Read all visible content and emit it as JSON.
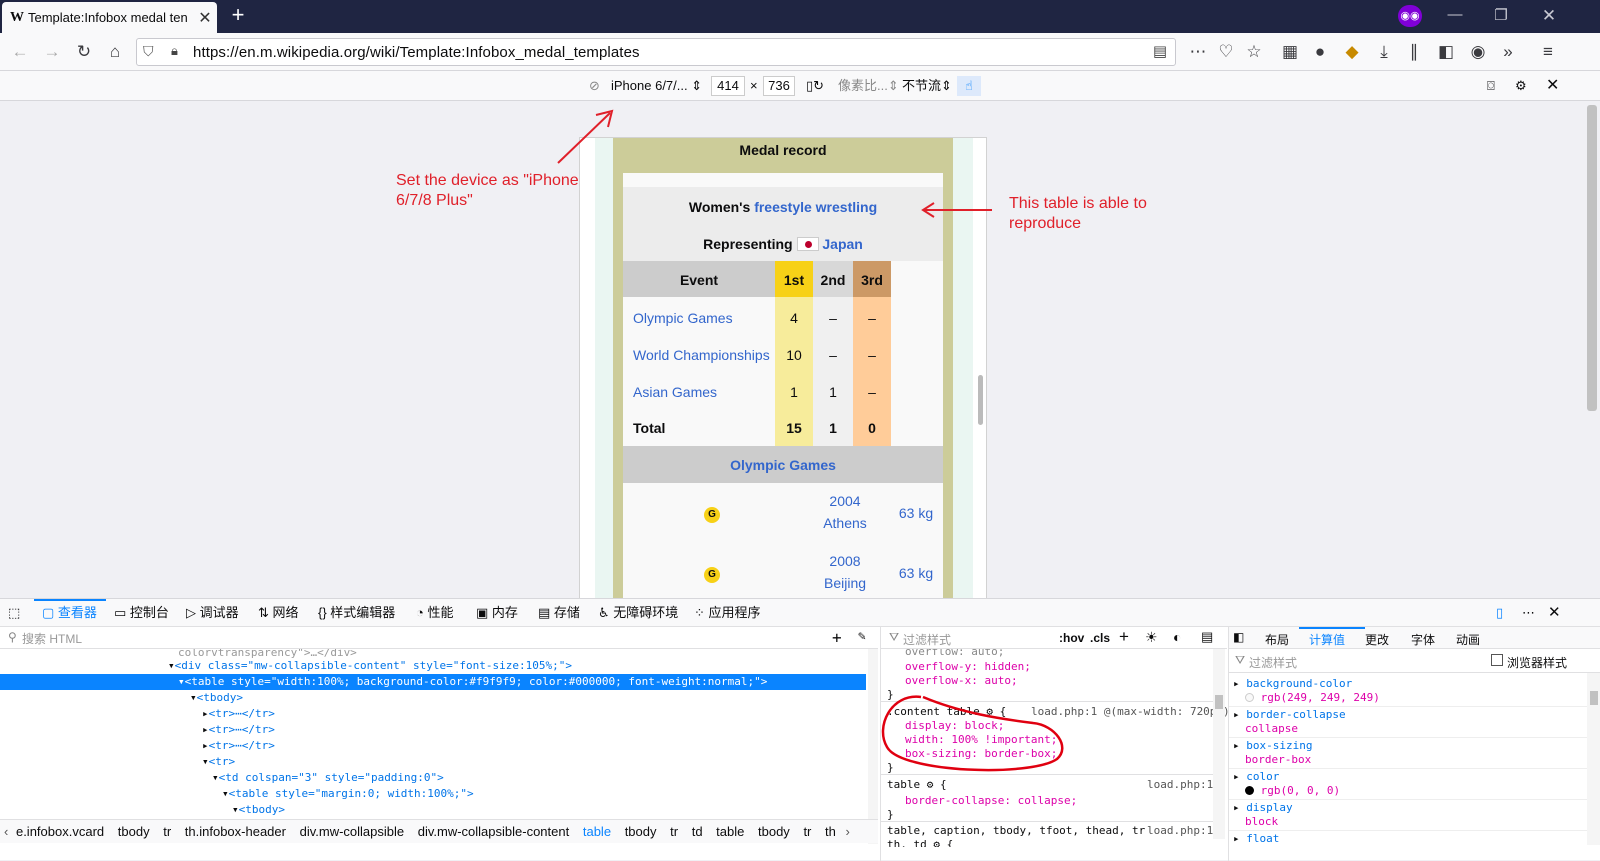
{
  "browser": {
    "tab_title": "Template:Infobox medal ten",
    "favicon": "W",
    "url": "https://en.m.wikipedia.org/wiki/Template:Infobox_medal_templates"
  },
  "rdm": {
    "device": "iPhone 6/7/...",
    "width": "414",
    "times": "×",
    "height": "736",
    "dpr": "像素比...",
    "throttle": "不节流"
  },
  "annotations": {
    "device_note": "Set the device as \"iPhone 6/7/8 Plus\"",
    "table_note": "This table is able to reproduce"
  },
  "infobox": {
    "title": "Medal record",
    "sport_prefix": "Women's",
    "sport_link": "freestyle wrestling",
    "representing": "Representing",
    "country": "Japan",
    "headers": [
      "Event",
      "1st",
      "2nd",
      "3rd"
    ],
    "rows": [
      {
        "event": "Olympic Games",
        "g": "4",
        "s": "–",
        "b": "–"
      },
      {
        "event": "World Championships",
        "g": "10",
        "s": "–",
        "b": "–"
      },
      {
        "event": "Asian Games",
        "g": "1",
        "s": "1",
        "b": "–"
      }
    ],
    "total": {
      "event": "Total",
      "g": "15",
      "s": "1",
      "b": "0"
    },
    "section": "Olympic Games",
    "medals": [
      {
        "badge": "G",
        "year": "2004",
        "place": "Athens",
        "weight": "63 kg"
      },
      {
        "badge": "G",
        "year": "2008",
        "place": "Beijing",
        "weight": "63 kg"
      }
    ]
  },
  "devtools": {
    "tabs": [
      "查看器",
      "控制台",
      "调试器",
      "网络",
      "样式编辑器",
      "性能",
      "内存",
      "存储",
      "无障碍环境",
      "应用程序"
    ],
    "search_placeholder": "搜索 HTML",
    "filter_placeholder": "过滤样式",
    "hov": ":hov",
    "cls": ".cls",
    "sidebar_tabs": [
      "布局",
      "计算值",
      "更改",
      "字体",
      "动画"
    ],
    "computed_filter": "过滤样式",
    "browser_styles": "浏览器样式",
    "markup_lines": [
      "colorvtransparency\">…</div>",
      "<div class=\"mw-collapsible-content\" style=\"font-size:105%;\">",
      "<table style=\"width:100%; background-color:#f9f9f9; color:#000000; font-weight:normal;\">",
      "<tbody>",
      "<tr>⋯</tr>",
      "<tr>⋯</tr>",
      "<tr>⋯</tr>",
      "<tr>",
      "<td colspan=\"3\" style=\"padding:0\">",
      "<table style=\"margin:0; width:100%;\">",
      "<tbody>"
    ],
    "breadcrumb": [
      "e.infobox.vcard",
      "tbody",
      "tr",
      "th.infobox-header",
      "div.mw-collapsible",
      "div.mw-collapsible-content",
      "table",
      "tbody",
      "tr",
      "td",
      "table",
      "tbody",
      "tr",
      "th"
    ],
    "rules": [
      "overflow: auto;",
      "overflow-y: hidden;",
      "overflow-x: auto;",
      "}",
      ".content table ⚙ {",
      "display: block;",
      "width: 100% !important;",
      "box-sizing: border-box;",
      "}",
      "table ⚙ {",
      "border-collapse: collapse;",
      "}",
      "table, caption, tbody, tfoot, thead, tr,",
      "th, td ⚙ {"
    ],
    "rule_sources": [
      "load.php:1 @(max-width: 720px)",
      "load.php:1",
      "load.php:1"
    ],
    "computed": [
      {
        "name": "background-color",
        "value": "rgb(249, 249, 249)"
      },
      {
        "name": "border-collapse",
        "value": "collapse"
      },
      {
        "name": "box-sizing",
        "value": "border-box"
      },
      {
        "name": "color",
        "value": "rgb(0, 0, 0)"
      },
      {
        "name": "display",
        "value": "block"
      },
      {
        "name": "float",
        "value": ""
      }
    ]
  }
}
